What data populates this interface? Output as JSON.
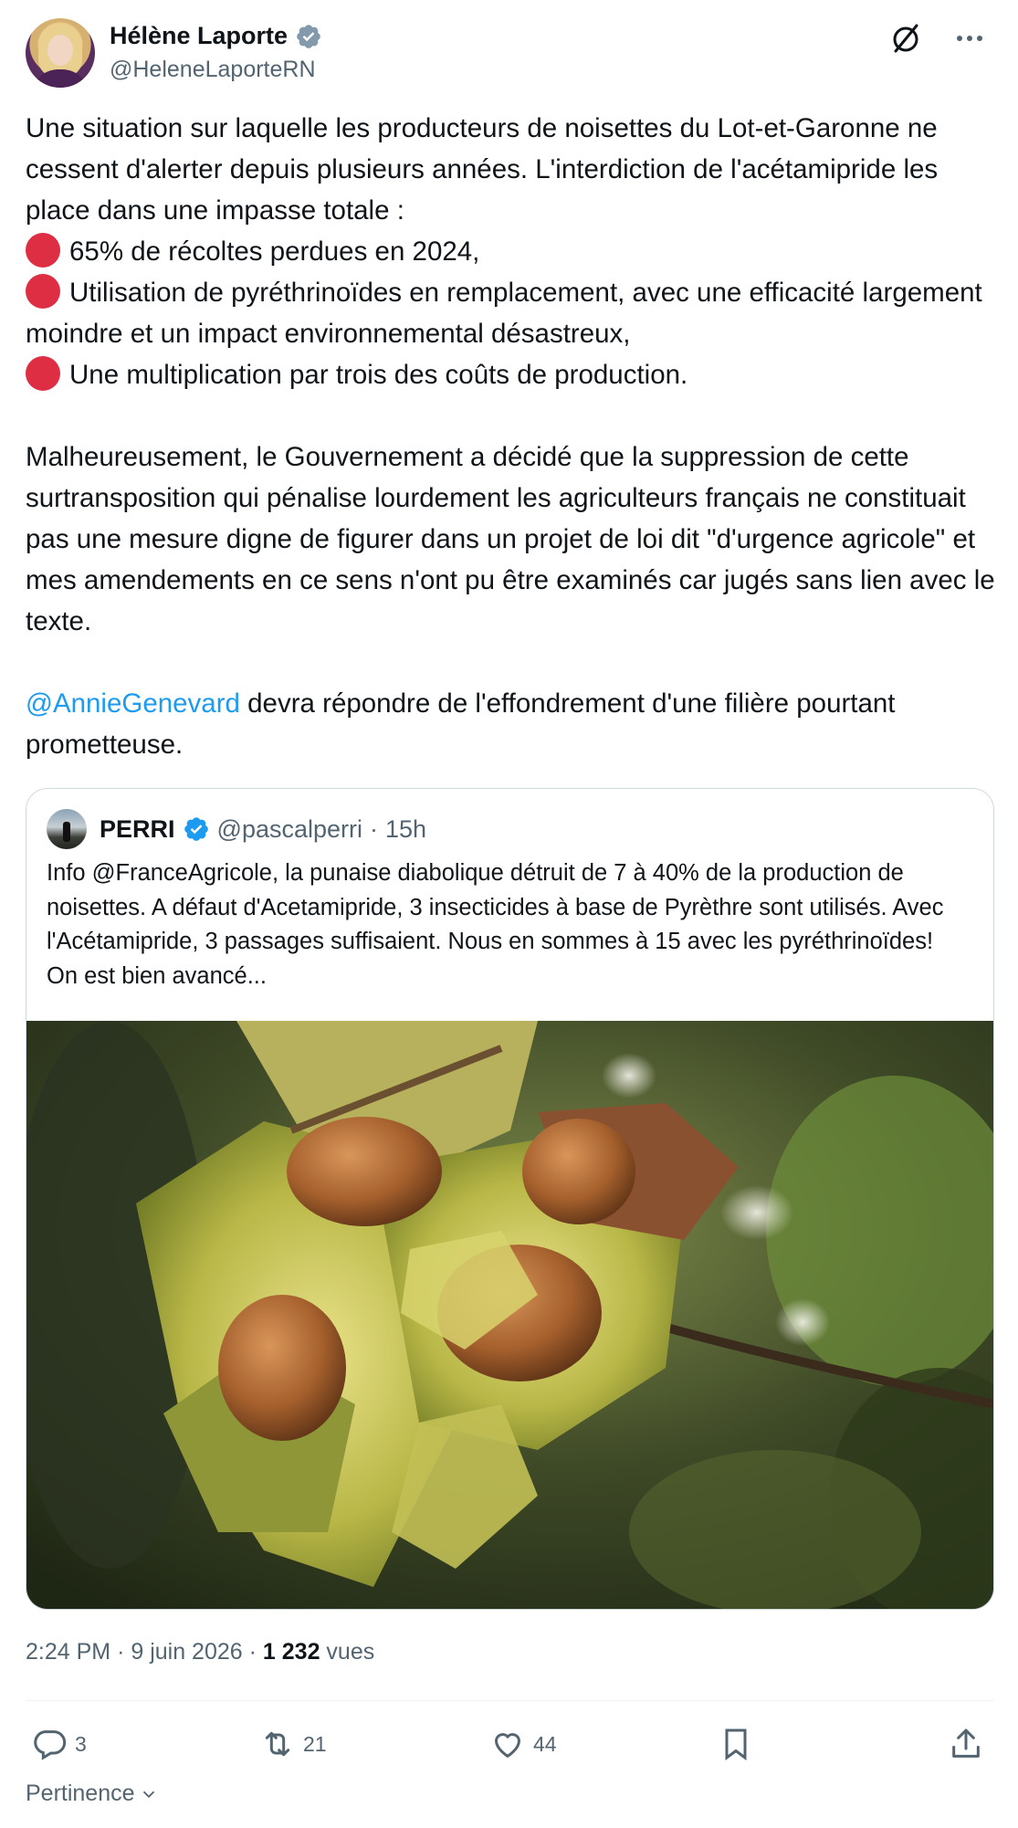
{
  "author": {
    "name": "Hélène Laporte",
    "handle": "@HeleneLaporteRN"
  },
  "icons": {
    "verified": "verified-badge-icon",
    "grok": "grok-icon",
    "more": "more-options-icon",
    "reply": "reply-icon",
    "retweet": "retweet-icon",
    "like": "like-icon",
    "bookmark": "bookmark-icon",
    "share": "share-icon",
    "chevron": "chevron-down-icon"
  },
  "colors": {
    "accent": "#1d9bf0",
    "verified_gray": "#829aab",
    "red_dot": "#dd2e44"
  },
  "tweet": {
    "line1": "Une situation sur laquelle les producteurs de noisettes du Lot-et-Garonne ne cessent d'alerter depuis plusieurs années. L'interdiction de l'acétamipride les place dans une impasse totale :",
    "bullet1": "65% de récoltes perdues en 2024,",
    "bullet2": "Utilisation de pyréthrinoïdes en remplacement, avec une efficacité largement moindre et un impact environnemental désastreux,",
    "bullet3": "Une multiplication par trois des coûts de production.",
    "para2": "Malheureusement, le Gouvernement a décidé que la suppression de cette surtransposition qui pénalise lourdement les agriculteurs français ne constituait pas une mesure digne de figurer dans un projet de loi dit \"d'urgence agricole\" et mes amendements en ce sens n'ont pu être examinés car jugés sans lien avec le texte.",
    "mention": "@AnnieGenevard",
    "para3_rest": " devra répondre de l'effondrement d'une filière pourtant prometteuse."
  },
  "quote": {
    "name": "PERRI",
    "handle": "@pascalperri",
    "separator": "·",
    "time": "15h",
    "text": "Info @FranceAgricole, la punaise diabolique détruit de 7 à 40% de la production de noisettes. A défaut d'Acetamipride, 3 insecticides à base de Pyrèthre sont utilisés. Avec l'Acétamipride, 3 passages suffisaient. Nous en sommes à 15 avec les pyréthrinoïdes! On est bien avancé..."
  },
  "meta": {
    "time": "2:24 PM",
    "date": "9 juin 2026",
    "sep": "·",
    "views_count": "1 232",
    "views_label": "vues"
  },
  "actions": {
    "replies": "3",
    "retweets": "21",
    "likes": "44"
  },
  "sort": {
    "label": "Pertinence"
  }
}
